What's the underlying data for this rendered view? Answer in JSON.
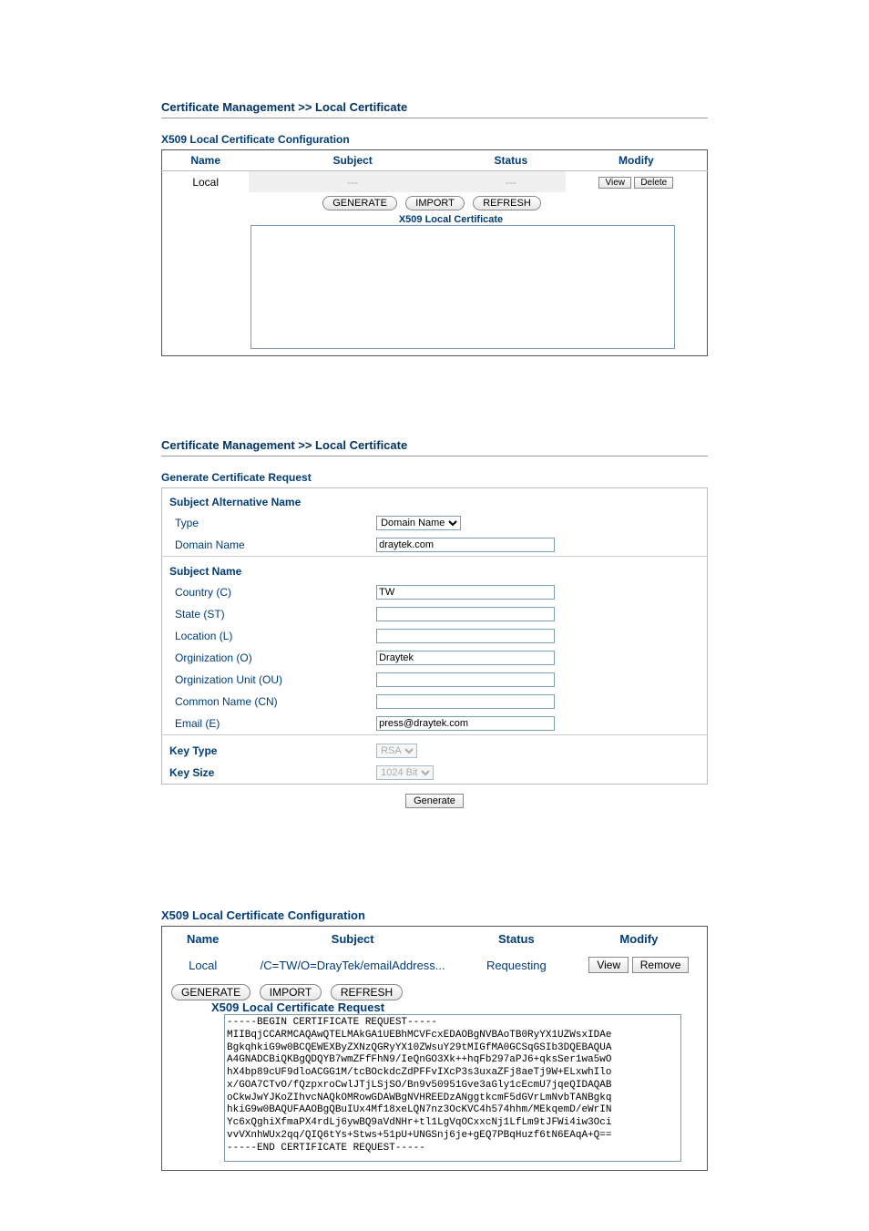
{
  "titles": {
    "main_title1": "Certificate Management >> Local Certificate",
    "config_heading1": "X509 Local Certificate Configuration",
    "inner_heading1": "X509 Local Certificate",
    "main_title2": "Certificate Management >> Local Certificate",
    "form_heading": "Generate Certificate Request",
    "config_heading2": "X509 Local Certificate Configuration",
    "inner_heading2": "X509 Local Certificate Request"
  },
  "table1": {
    "headers": {
      "name": "Name",
      "subject": "Subject",
      "status": "Status",
      "modify": "Modify"
    },
    "row": {
      "name": "Local",
      "subject": "---",
      "status": "---"
    },
    "modify_buttons": {
      "view": "View",
      "delete": "Delete"
    },
    "actions": {
      "generate": "GENERATE",
      "import": "IMPORT",
      "refresh": "REFRESH"
    }
  },
  "form": {
    "group_san": "Subject Alternative Name",
    "type_label": "Type",
    "type_option": "Domain Name",
    "domain_label": "Domain Name",
    "domain_value": "draytek.com",
    "group_subject": "Subject Name",
    "country_label": "Country (C)",
    "country_value": "TW",
    "state_label": "State (ST)",
    "state_value": "",
    "location_label": "Location (L)",
    "location_value": "",
    "org_label": "Orginization (O)",
    "org_value": "Draytek",
    "ou_label": "Orginization Unit (OU)",
    "ou_value": "",
    "cn_label": "Common Name (CN)",
    "cn_value": "",
    "email_label": "Email (E)",
    "email_value": "press@draytek.com",
    "key_type_label": "Key Type",
    "key_type_option": "RSA",
    "key_size_label": "Key Size",
    "key_size_option": "1024 Bit",
    "generate_btn": "Generate"
  },
  "table2": {
    "headers": {
      "name": "Name",
      "subject": "Subject",
      "status": "Status",
      "modify": "Modify"
    },
    "row": {
      "name": "Local",
      "subject": "/C=TW/O=DrayTek/emailAddress...",
      "status": "Requesting"
    },
    "modify_buttons": {
      "view": "View",
      "remove": "Remove"
    },
    "actions": {
      "generate": "GENERATE",
      "import": "IMPORT",
      "refresh": "REFRESH"
    },
    "cert_text": "-----BEGIN CERTIFICATE REQUEST-----\nMIIBqjCCARMCAQAwQTELMAkGA1UEBhMCVFcxEDAOBgNVBAoTB0RyYX1UZWsxIDAe\nBgkqhkiG9w0BCQEWEXByZXNzQGRyYX10ZWsuY29tMIGfMA0GCSqGSIb3DQEBAQUA\nA4GNADCBiQKBgQDQYB7wmZFfFhN9/IeQnGO3Xk++hqFb297aPJ6+qksSer1wa5wO\nhX4bp89cUF9dloACGG1M/tcBOckdcZdPFFvIXcP3s3uxaZFj8aeTj9W+ELxwhIlo\nx/GOA7CTvO/fQzpxroCwlJTjLSjSO/Bn9v50951Gve3aGly1cEcmU7jqeQIDAQAB\noCkwJwYJKoZIhvcNAQkOMRowGDAWBgNVHREEDzANggtkcmF5dGVrLmNvbTANBgkq\nhkiG9w0BAQUFAAOBgQBuIUx4Mf18xeLQN7nz3OcKVC4h574hhm/MEkqemD/eWrIN\nYc6xQghiXfmaPX4rdLj6ywBQ9aVdNHr+tl1LgVqOCxxcNj1LfLm9tJFWi4iw3Oci\nvvVXnhWUx2qq/QIQ6tYs+Stws+51pU+UNGSnj6je+gEQ7PBqHuzf6tN6EAqA+Q==\n-----END CERTIFICATE REQUEST-----"
  }
}
